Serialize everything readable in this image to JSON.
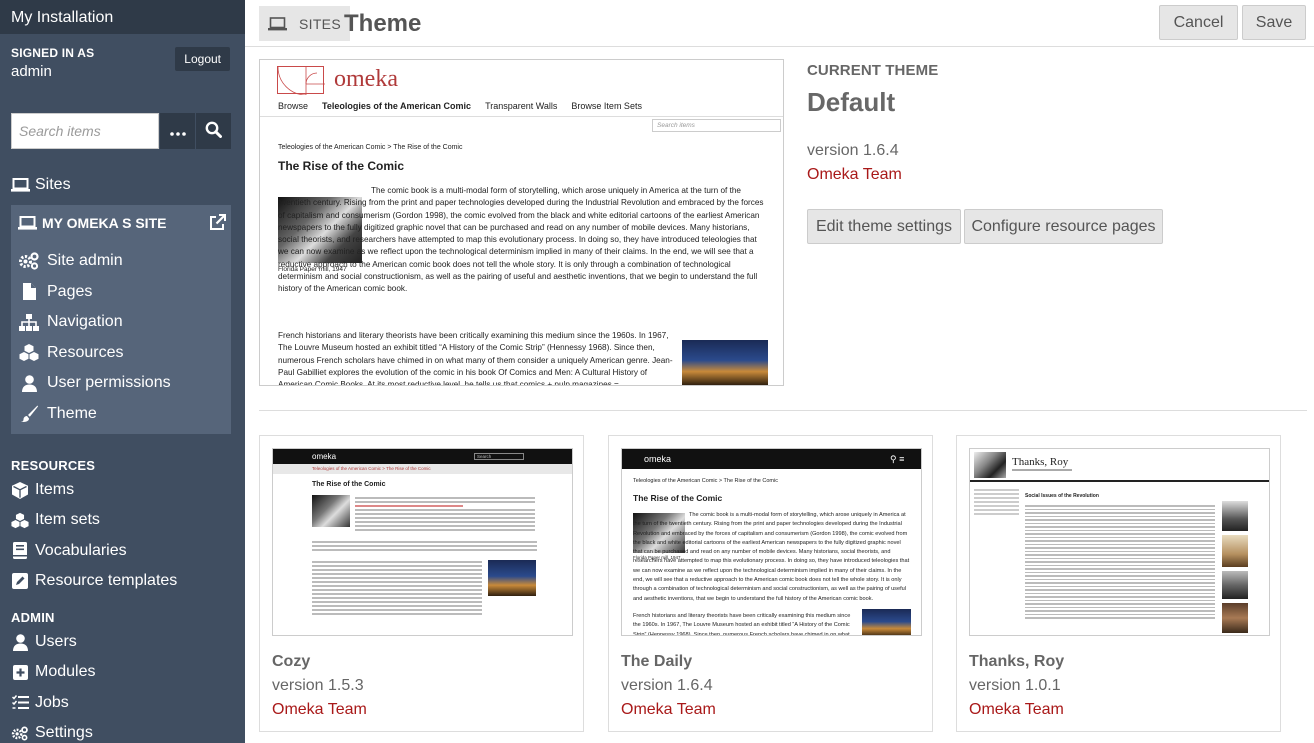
{
  "sidebar": {
    "install_title": "My Installation",
    "signed_in_label": "SIGNED IN AS",
    "username": "admin",
    "logout_label": "Logout",
    "search_placeholder": "Search items",
    "sites_label": "Sites",
    "site_name": "MY OMEKA S SITE",
    "site_items": [
      {
        "label": "Site admin",
        "icon": "cogs-icon"
      },
      {
        "label": "Pages",
        "icon": "file-icon"
      },
      {
        "label": "Navigation",
        "icon": "sitemap-icon"
      },
      {
        "label": "Resources",
        "icon": "cubes-icon"
      },
      {
        "label": "User permissions",
        "icon": "user-icon"
      },
      {
        "label": "Theme",
        "icon": "paint-brush-icon"
      }
    ],
    "resources_title": "RESOURCES",
    "resources": [
      {
        "label": "Items",
        "icon": "cube-icon"
      },
      {
        "label": "Item sets",
        "icon": "cubes-icon"
      },
      {
        "label": "Vocabularies",
        "icon": "book-icon"
      },
      {
        "label": "Resource templates",
        "icon": "edit-icon"
      }
    ],
    "admin_title": "ADMIN",
    "admin": [
      {
        "label": "Users",
        "icon": "user-icon"
      },
      {
        "label": "Modules",
        "icon": "plus-square-icon"
      },
      {
        "label": "Jobs",
        "icon": "tasks-icon"
      },
      {
        "label": "Settings",
        "icon": "cogs-icon"
      }
    ]
  },
  "header": {
    "breadcrumb": "SITES",
    "title": "Theme",
    "cancel_label": "Cancel",
    "save_label": "Save"
  },
  "current_theme": {
    "label": "CURRENT THEME",
    "name": "Default",
    "version": "version 1.6.4",
    "author": "Omeka Team",
    "edit_settings_label": "Edit theme settings",
    "configure_pages_label": "Configure resource pages",
    "preview": {
      "logo": "omeka",
      "nav": [
        "Browse",
        "Teleologies of the American Comic",
        "Transparent Walls",
        "Browse Item Sets"
      ],
      "search_placeholder": "Search items",
      "breadcrumb": "Teleologies of the American Comic > The Rise of the Comic",
      "heading": "The Rise of the Comic",
      "caption": "Florida Paper mill, 1947",
      "paragraph1": "The comic book is a multi-modal form of storytelling, which arose uniquely in America at the turn of the twentieth century. Rising from the print and paper technologies developed during the Industrial Revolution and embraced by the forces of capitalism and consumerism (Gordon 1998), the comic evolved from the black and white editorial cartoons of the earliest American newspapers to the fully digitized graphic novel that can be purchased and read on any number of mobile devices. Many historians, social theorists, and researchers have attempted to map this evolutionary process. In doing so, they have introduced teleologies that we can now examine as we reflect upon the technological determinism implied in many of their claims. In the end, we will see that a reductive approach to the American comic book does not tell the whole story. It is only through a combination of technological determinism and social constructionism, as well as the pairing of useful and aesthetic inventions, that we begin to understand the full history of the American comic book.",
      "paragraph2": "French historians and literary theorists have been critically examining this medium since the 1960s. In 1967, The Louvre Museum hosted an exhibit titled “A History of the Comic Strip” (Hennessy 1968). Since then, numerous French scholars have chimed in on what many of them consider a uniquely American genre. Jean-Paul Gabilliet explores the evolution of the comic in his book Of Comics and Men: A Cultural History of American Comic Books. At its most reductive level, he tells us that comics + pulp magazines ="
    }
  },
  "themes": [
    {
      "name": "Cozy",
      "version": "version 1.5.3",
      "author": "Omeka Team"
    },
    {
      "name": "The Daily",
      "version": "version 1.6.4",
      "author": "Omeka Team"
    },
    {
      "name": "Thanks, Roy",
      "version": "version 1.0.1",
      "author": "Omeka Team"
    }
  ],
  "previews": {
    "cozy": {
      "logo": "omeka",
      "search": "Search",
      "breadcrumb": "Teleologies of the American Comic > The Rise of the Comic",
      "heading": "The Rise of the Comic"
    },
    "daily": {
      "logo": "omeka",
      "breadcrumb": "Teleologies of the American Comic > The Rise of the Comic",
      "heading": "The Rise of the Comic",
      "caption": "Florida Paper mill, 1947",
      "paragraph1": "The comic book is a multi-modal form of storytelling, which arose uniquely in America at the turn of the twentieth century. Rising from the print and paper technologies developed during the Industrial Revolution and embraced by the forces of capitalism and consumerism (Gordon 1998), the comic evolved from the black and white editorial cartoons of the earliest American newspapers to the fully digitized graphic novel that can be purchased and read on any number of mobile devices. Many historians, social theorists, and researchers have attempted to map this evolutionary process. In doing so, they have introduced teleologies that we can now examine as we reflect upon the technological determinism implied in many of their claims. In the end, we will see that a reductive approach to the American comic book does not tell the whole story. It is only through a combination of technological determinism and social constructionism, as well as the pairing of useful and aesthetic inventions, that we begin to understand the full history of the American comic book.",
      "paragraph2": "French historians and literary theorists have been critically examining this medium since the 1960s. In 1967, The Louvre Museum hosted an exhibit titled “A History of the Comic Strip” (Hennessy 1968). Since then, numerous French scholars have chimed in on what many of them consider a uniquely American"
    },
    "roy": {
      "title": "Thanks, Roy",
      "heading": "Social Issues of the Revolution"
    }
  },
  "colors": {
    "sidebar_bg": "#404e61",
    "sidebar_dark": "#2f3a48",
    "site_box_bg": "#56657a",
    "author_red": "#a91919"
  }
}
